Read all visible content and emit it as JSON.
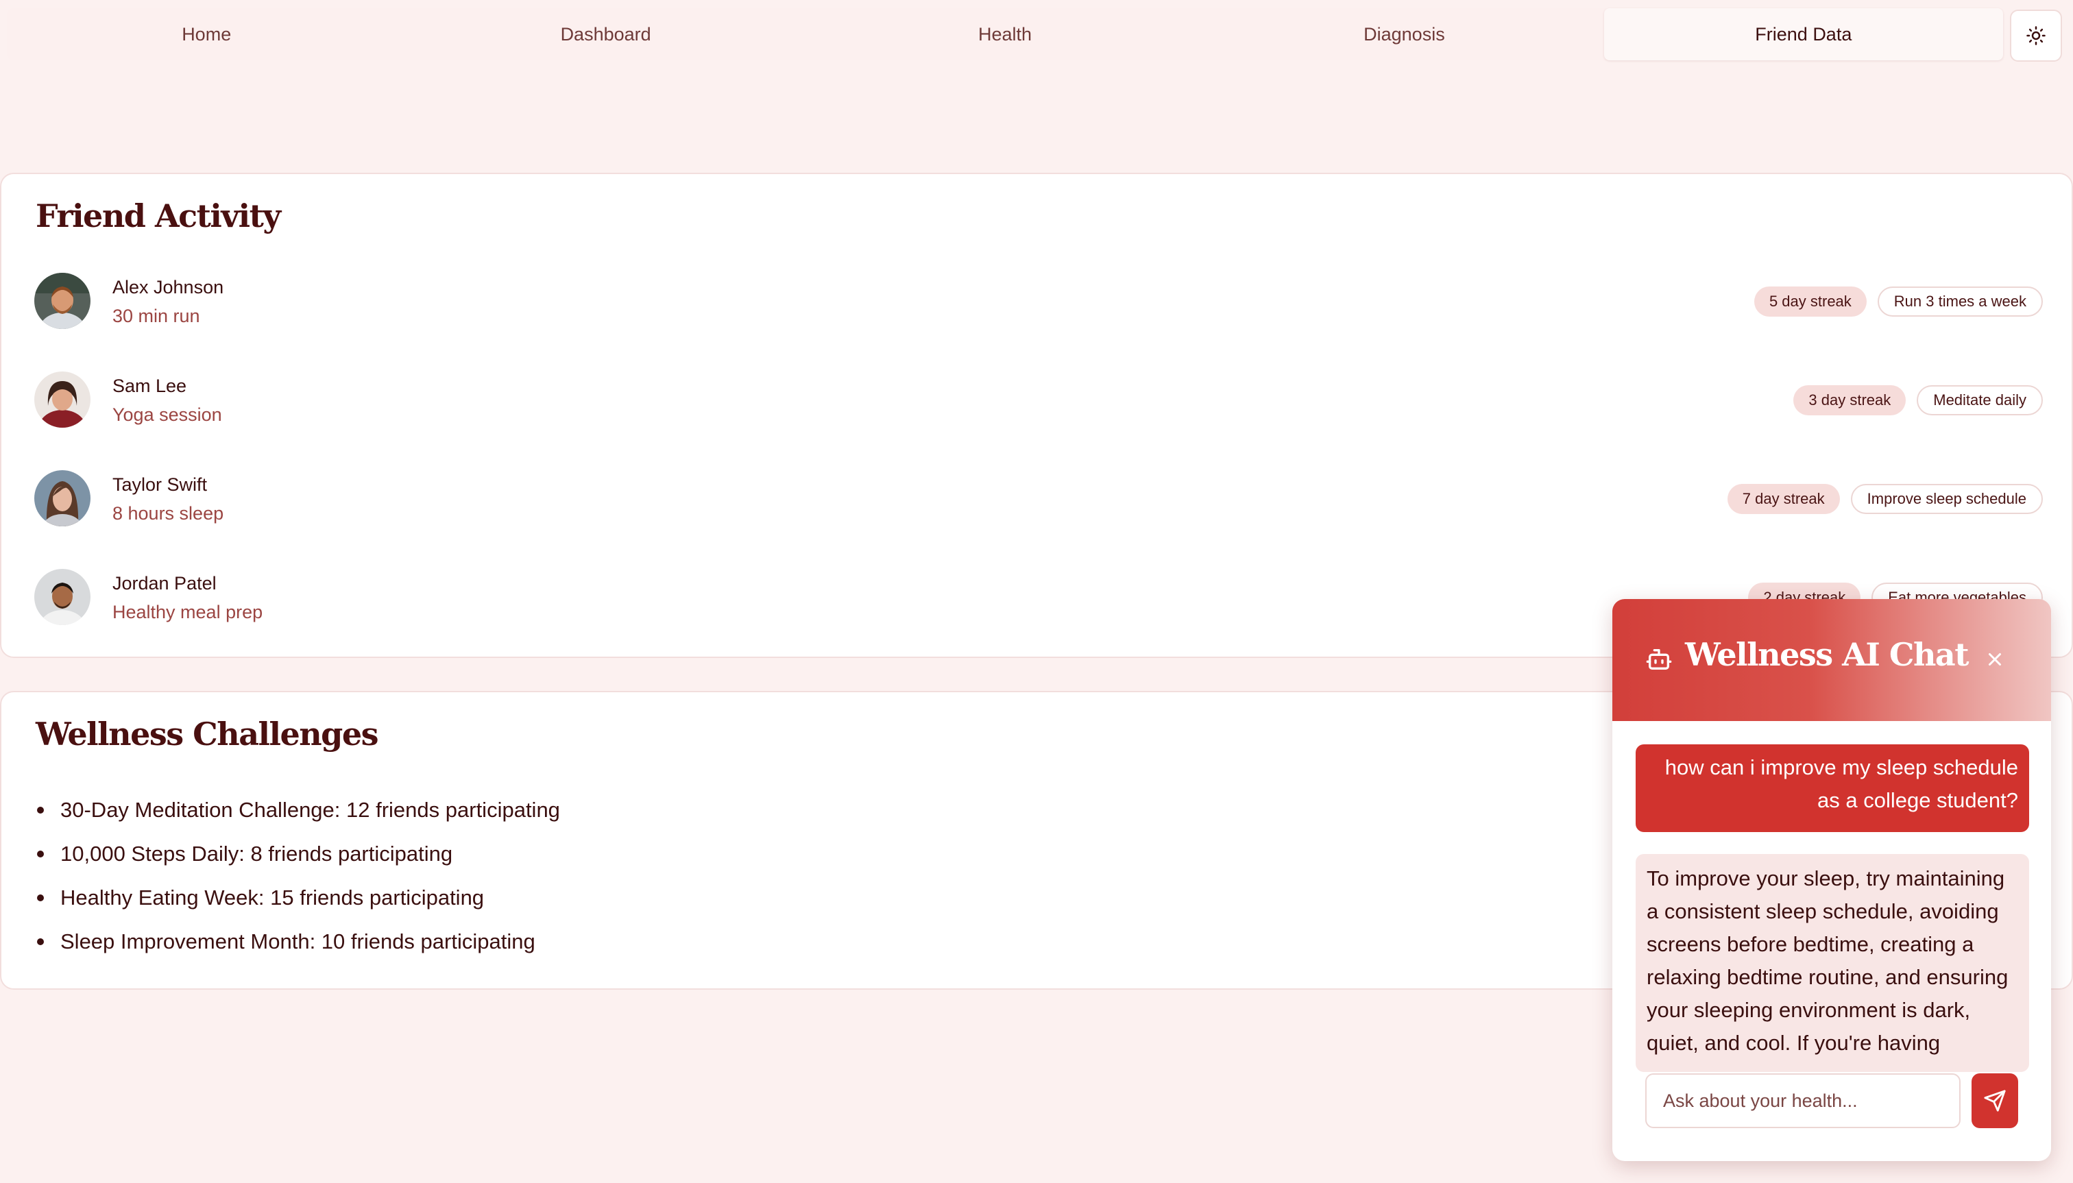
{
  "nav": {
    "tabs": [
      {
        "label": "Home"
      },
      {
        "label": "Dashboard"
      },
      {
        "label": "Health"
      },
      {
        "label": "Diagnosis"
      },
      {
        "label": "Friend Data",
        "active": true
      }
    ],
    "theme_icon": "sun-icon"
  },
  "friend_activity": {
    "title": "Friend Activity",
    "friends": [
      {
        "name": "Alex Johnson",
        "activity": "30 min run",
        "streak": "5 day streak",
        "goal": "Run 3 times a week"
      },
      {
        "name": "Sam Lee",
        "activity": "Yoga session",
        "streak": "3 day streak",
        "goal": "Meditate daily"
      },
      {
        "name": "Taylor Swift",
        "activity": "8 hours sleep",
        "streak": "7 day streak",
        "goal": "Improve sleep schedule"
      },
      {
        "name": "Jordan Patel",
        "activity": "Healthy meal prep",
        "streak": "2 day streak",
        "goal": "Eat more vegetables"
      }
    ]
  },
  "wellness_challenges": {
    "title": "Wellness Challenges",
    "items": [
      "30-Day Meditation Challenge: 12 friends participating",
      "10,000 Steps Daily: 8 friends participating",
      "Healthy Eating Week: 15 friends participating",
      "Sleep Improvement Month: 10 friends participating"
    ]
  },
  "chat": {
    "title": "Wellness AI Chat",
    "bot_icon": "bot-icon",
    "close_icon": "close-icon",
    "user_message": "how can i improve my sleep schedule as a college student?",
    "bot_message": "To improve your sleep, try maintaining a consistent sleep schedule, avoiding screens before bedtime, creating a relaxing bedtime routine, and ensuring your sleeping environment is dark, quiet, and cool. If you're having",
    "input_placeholder": "Ask about your health...",
    "send_icon": "send-icon"
  },
  "colors": {
    "background": "#fcf1f0",
    "accent": "#d1332e",
    "title": "#4a1010",
    "streak_badge": "#f6dcda",
    "activity_text": "#9b4542"
  }
}
